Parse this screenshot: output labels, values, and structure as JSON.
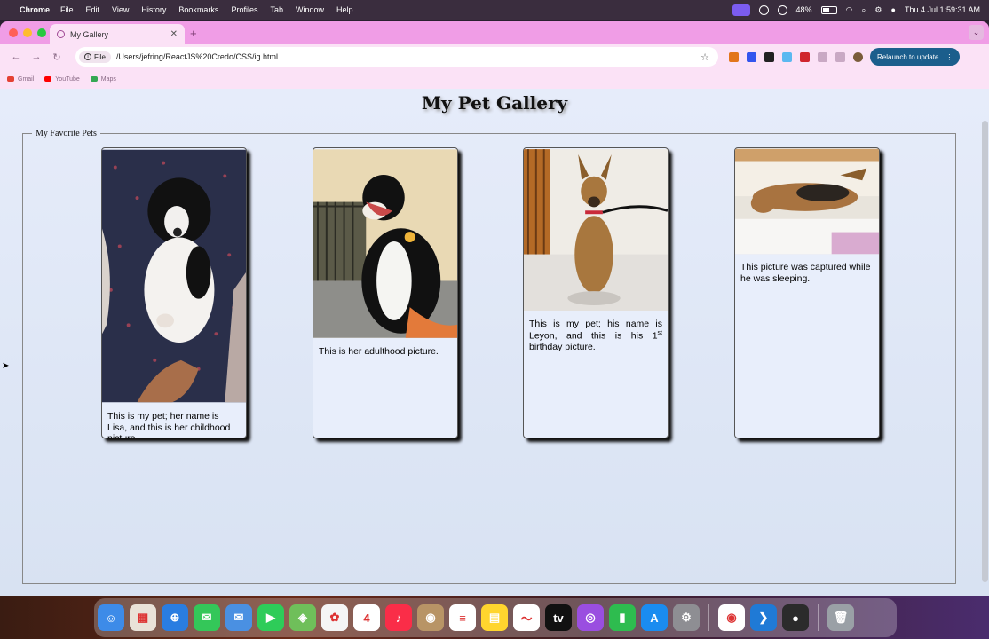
{
  "menubar": {
    "app": "Chrome",
    "menus": [
      "File",
      "Edit",
      "View",
      "History",
      "Bookmarks",
      "Profiles",
      "Tab",
      "Window",
      "Help"
    ],
    "battery": "48%",
    "clock": "Thu 4 Jul  1:59:31 AM"
  },
  "browser": {
    "tab_title": "My Gallery",
    "url_chip": "File",
    "url": "/Users/jefring/ReactJS%20Credo/CSS/ig.html",
    "relaunch_label": "Relaunch to update",
    "bookmarks": [
      {
        "label": "Gmail",
        "color": "#e44134"
      },
      {
        "label": "YouTube",
        "color": "#ff0000"
      },
      {
        "label": "Maps",
        "color": "#34a853"
      }
    ]
  },
  "page": {
    "title": "My Pet Gallery",
    "legend": "My Favorite Pets",
    "cards": [
      {
        "caption": "This is my pet; her name is Lisa, and this is her childhood picture.",
        "photo": "puppy-on-blanket"
      },
      {
        "caption": "This is her adulthood picture.",
        "photo": "dog-on-balcony"
      },
      {
        "caption_pre": "This is my pet; his name is Leyon, and this is his 1",
        "caption_sup": "st",
        "caption_post": " birthday picture.",
        "photo": "dog-sitting-indoors"
      },
      {
        "caption": "This picture was captured while he was sleeping.",
        "photo": "dog-sleeping"
      }
    ]
  },
  "dock": {
    "apps": [
      {
        "name": "finder",
        "color": "#3d8be8",
        "glyph": "☺"
      },
      {
        "name": "launchpad",
        "color": "#e9e2d8",
        "glyph": "▦"
      },
      {
        "name": "safari",
        "color": "#2a7de1",
        "glyph": "⊕"
      },
      {
        "name": "messages",
        "color": "#34c759",
        "glyph": "✉"
      },
      {
        "name": "mail",
        "color": "#4a90e2",
        "glyph": "✉"
      },
      {
        "name": "facetime",
        "color": "#2ecc59",
        "glyph": "▶"
      },
      {
        "name": "maps",
        "color": "#6fbf5a",
        "glyph": "◈"
      },
      {
        "name": "photos",
        "color": "#f5f5f5",
        "glyph": "✿"
      },
      {
        "name": "calendar",
        "color": "#ffffff",
        "glyph": "4"
      },
      {
        "name": "music",
        "color": "#fa2d48",
        "glyph": "♪"
      },
      {
        "name": "contacts",
        "color": "#b89466",
        "glyph": "◉"
      },
      {
        "name": "reminders",
        "color": "#ffffff",
        "glyph": "≡"
      },
      {
        "name": "notes",
        "color": "#ffd52e",
        "glyph": "▤"
      },
      {
        "name": "freeform",
        "color": "#ffffff",
        "glyph": "〜"
      },
      {
        "name": "apple-tv",
        "color": "#111111",
        "glyph": "tv"
      },
      {
        "name": "podcasts",
        "color": "#9a4ee0",
        "glyph": "◎"
      },
      {
        "name": "numbers",
        "color": "#2ebc4f",
        "glyph": "▮"
      },
      {
        "name": "app-store",
        "color": "#1a8cf0",
        "glyph": "A"
      },
      {
        "name": "system-settings",
        "color": "#8e8e93",
        "glyph": "⚙"
      },
      {
        "name": "chrome",
        "color": "#ffffff",
        "glyph": "◉"
      },
      {
        "name": "vscode",
        "color": "#1f7ad6",
        "glyph": "❯"
      },
      {
        "name": "obs",
        "color": "#2b2b2b",
        "glyph": "●"
      },
      {
        "name": "trash",
        "color": "#9aa0a6",
        "glyph": "🗑"
      }
    ]
  }
}
